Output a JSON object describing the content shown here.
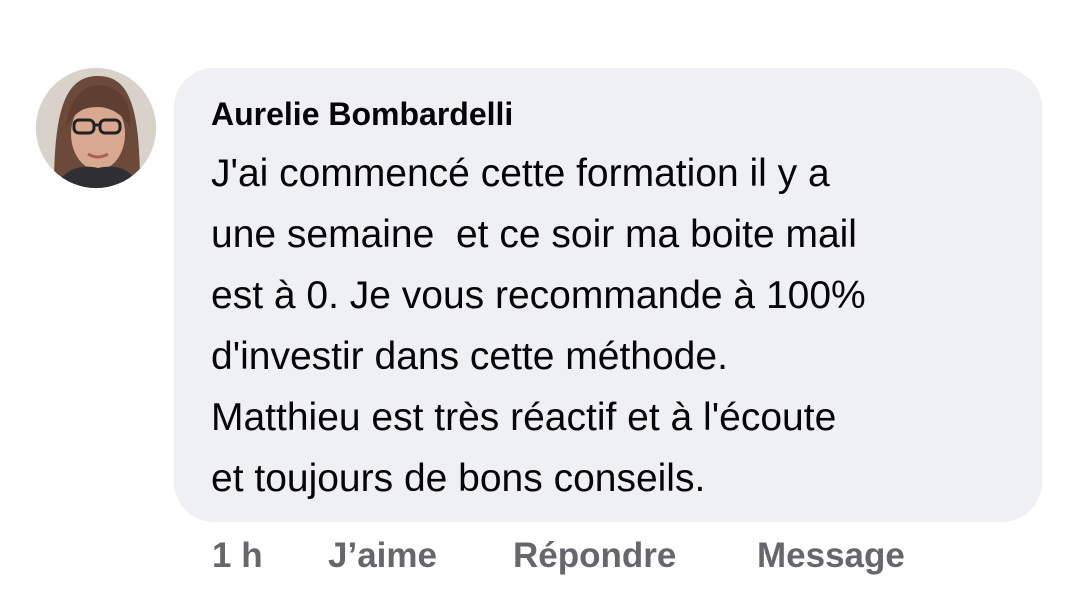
{
  "comment": {
    "author": "Aurelie Bombardelli",
    "text_lines": [
      "J'ai commencé cette formation il y a",
      "une semaine  et ce soir ma boite mail",
      "est à 0. Je vous recommande à 100%",
      "d'investir dans cette méthode.",
      "Matthieu est très réactif et à l'écoute",
      "et toujours de bons conseils."
    ],
    "avatar_icon": "profile-photo"
  },
  "actions": {
    "time": "1 h",
    "like_label": "J’aime",
    "reply_label": "Répondre",
    "message_label": "Message"
  },
  "colors": {
    "bubble_bg": "#eff0f4",
    "text": "#050505",
    "action_text": "#65676b"
  }
}
